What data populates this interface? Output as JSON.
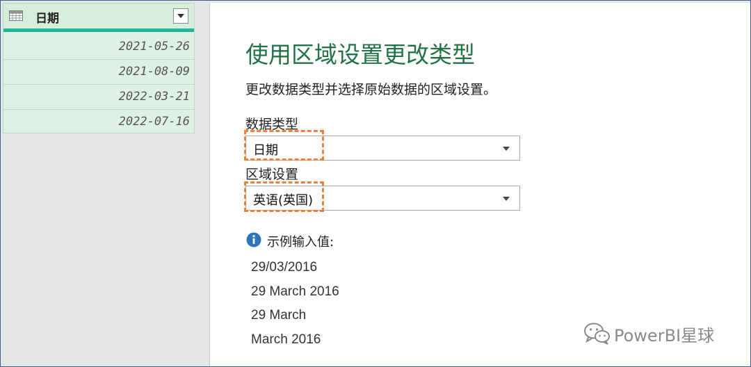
{
  "column": {
    "header": "日期",
    "rows": [
      "2021-05-26",
      "2021-08-09",
      "2022-03-21",
      "2022-07-16"
    ]
  },
  "dialog": {
    "title": "使用区域设置更改类型",
    "description": "更改数据类型并选择原始数据的区域设置。",
    "data_type_label": "数据类型",
    "data_type_value": "日期",
    "locale_label": "区域设置",
    "locale_value": "英语(英国)",
    "examples_label": "示例输入值:",
    "examples": [
      "29/03/2016",
      "29 March 2016",
      "29 March",
      "March 2016"
    ]
  },
  "watermark": {
    "text": "PowerBI星球"
  },
  "colors": {
    "accent_green": "#217346",
    "highlight_orange": "#ef7f3a",
    "column_bg": "#dff1e4",
    "column_accent": "#1fb59a",
    "info_blue": "#2e75b6"
  }
}
